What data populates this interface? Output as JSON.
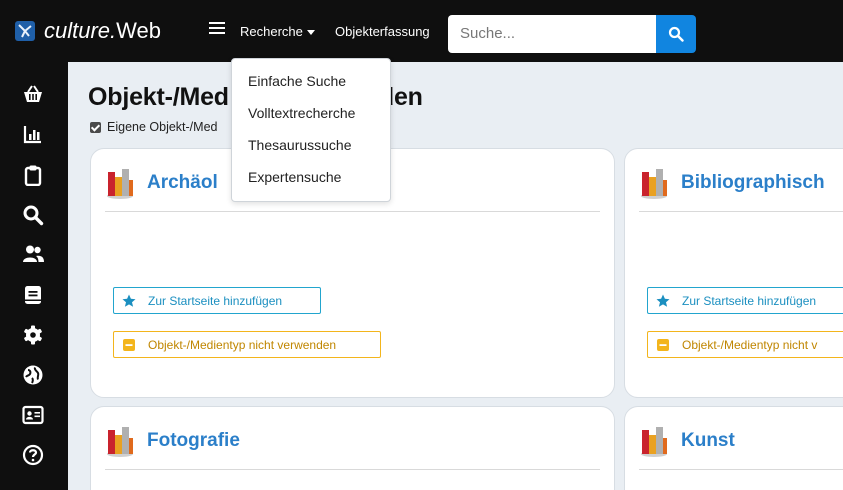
{
  "brand": {
    "prefix": "culture.",
    "suffix": "Web"
  },
  "nav": {
    "recherche_label": "Recherche",
    "objekterfassung_label": "Objekterfassung",
    "search_placeholder": "Suche..."
  },
  "dropdown": {
    "items": [
      "Einfache Suche",
      "Volltextrecherche",
      "Thesaurussuche",
      "Expertensuche"
    ]
  },
  "sidebar": {
    "icons": [
      "basket-icon",
      "bar-chart-icon",
      "clipboard-icon",
      "search-icon",
      "users-icon",
      "book-icon",
      "gear-icon",
      "globe-icon",
      "id-card-icon",
      "help-icon"
    ]
  },
  "main": {
    "title": "Objekt-/Med",
    "title_end": "den",
    "checkbox_label": "Eigene Objekt-/Med"
  },
  "cards": [
    {
      "title": "Archäol",
      "add_label": "Zur Startseite hinzufügen",
      "remove_label": "Objekt-/Medientyp nicht verwenden"
    },
    {
      "title": "Bibliographisch",
      "add_label": "Zur Startseite hinzufügen",
      "remove_label": "Objekt-/Medientyp nicht v"
    },
    {
      "title": "Fotografie"
    },
    {
      "title": "Kunst"
    }
  ],
  "colors": {
    "topbar": "#0f0f0f",
    "accent": "#1185e0",
    "card_title": "#2b7fc9",
    "add_border": "#22a5ce",
    "remove_border": "#f3b51c",
    "background": "#e9eef3"
  }
}
